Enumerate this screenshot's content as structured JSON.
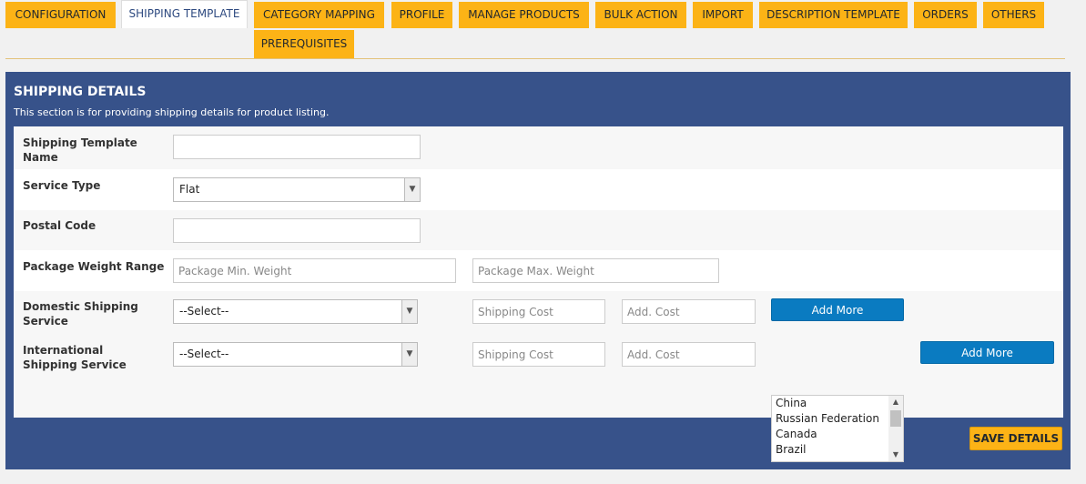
{
  "tabs": [
    {
      "label": "CONFIGURATION",
      "active": false
    },
    {
      "label": "SHIPPING TEMPLATE",
      "active": true
    },
    {
      "label": "CATEGORY MAPPING",
      "active": false
    },
    {
      "label": "PROFILE",
      "active": false
    },
    {
      "label": "MANAGE PRODUCTS",
      "active": false
    },
    {
      "label": "BULK ACTION",
      "active": false
    },
    {
      "label": "IMPORT",
      "active": false
    },
    {
      "label": "DESCRIPTION TEMPLATE",
      "active": false
    },
    {
      "label": "ORDERS",
      "active": false
    },
    {
      "label": "OTHERS",
      "active": false
    },
    {
      "label": "PREREQUISITES",
      "active": false
    }
  ],
  "section": {
    "title": "SHIPPING DETAILS",
    "description": "This section is for providing shipping details for product listing."
  },
  "form": {
    "template_name": {
      "label": "Shipping Template Name",
      "value": ""
    },
    "service_type": {
      "label": "Service Type",
      "selected": "Flat"
    },
    "postal_code": {
      "label": "Postal Code",
      "value": ""
    },
    "weight_range": {
      "label": "Package Weight Range",
      "min_placeholder": "Package Min. Weight",
      "max_placeholder": "Package Max. Weight"
    },
    "domestic": {
      "label": "Domestic Shipping Service",
      "selected": "--Select--",
      "cost_placeholder": "Shipping Cost",
      "add_cost_placeholder": "Add. Cost",
      "add_more_label": "Add More"
    },
    "international": {
      "label": "International Shipping Service",
      "selected": "--Select--",
      "cost_placeholder": "Shipping Cost",
      "add_cost_placeholder": "Add. Cost",
      "countries": [
        "China",
        "Russian Federation",
        "Canada",
        "Brazil"
      ],
      "add_more_label": "Add More"
    }
  },
  "save_label": "SAVE DETAILS",
  "colors": {
    "tab_bg": "#fcb316",
    "panel_bg": "#37528a",
    "button_blue": "#0a7bc1"
  }
}
